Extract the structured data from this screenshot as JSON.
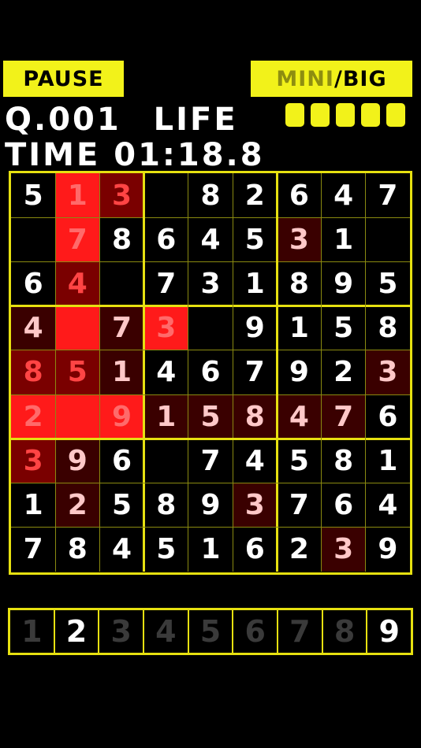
{
  "buttons": {
    "pause": "PAUSE",
    "mini": "MINI",
    "slash": "/",
    "big": "BIG"
  },
  "hud": {
    "question_label": "Q.",
    "question_number": "001",
    "life_label": "LIFE",
    "life_remaining": 5,
    "time_label": "TIME",
    "time_value": "01:18.8"
  },
  "colors": {
    "accent_yellow": "#f2f21a",
    "grid_line": "#e6e010",
    "red_bright": "#ff1a1a",
    "red_mid": "#c01010",
    "red_dark": "#7a0000",
    "red_faint": "#3a0000"
  },
  "board": {
    "rows": [
      [
        "5",
        "1",
        "3",
        "",
        "8",
        "2",
        "6",
        "4",
        "7"
      ],
      [
        "",
        "7",
        "8",
        "6",
        "4",
        "5",
        "3",
        "1",
        ""
      ],
      [
        "6",
        "4",
        "",
        "7",
        "3",
        "1",
        "8",
        "9",
        "5"
      ],
      [
        "4",
        "",
        "7",
        "3",
        "",
        "9",
        "1",
        "5",
        "8"
      ],
      [
        "8",
        "5",
        "1",
        "4",
        "6",
        "7",
        "9",
        "2",
        "3"
      ],
      [
        "2",
        "",
        "9",
        "1",
        "5",
        "8",
        "4",
        "7",
        "6"
      ],
      [
        "3",
        "9",
        "6",
        "",
        "7",
        "4",
        "5",
        "8",
        "1"
      ],
      [
        "1",
        "2",
        "5",
        "8",
        "9",
        "3",
        "7",
        "6",
        "4"
      ],
      [
        "7",
        "8",
        "4",
        "5",
        "1",
        "6",
        "2",
        "3",
        "9"
      ]
    ],
    "shade": [
      [
        0,
        3,
        2,
        0,
        0,
        0,
        0,
        0,
        0
      ],
      [
        0,
        3,
        0,
        0,
        0,
        0,
        1,
        0,
        0
      ],
      [
        0,
        2,
        0,
        0,
        0,
        0,
        0,
        0,
        0
      ],
      [
        1,
        3,
        1,
        3,
        0,
        0,
        0,
        0,
        0
      ],
      [
        2,
        2,
        1,
        0,
        0,
        0,
        0,
        0,
        1
      ],
      [
        3,
        3,
        3,
        1,
        1,
        1,
        1,
        1,
        0
      ],
      [
        2,
        1,
        0,
        0,
        0,
        0,
        0,
        0,
        0
      ],
      [
        0,
        1,
        0,
        0,
        0,
        1,
        0,
        0,
        0
      ],
      [
        0,
        0,
        0,
        0,
        0,
        0,
        0,
        1,
        0
      ]
    ]
  },
  "numbers": [
    {
      "label": "1",
      "state": "disabled"
    },
    {
      "label": "2",
      "state": "active"
    },
    {
      "label": "3",
      "state": "disabled"
    },
    {
      "label": "4",
      "state": "disabled"
    },
    {
      "label": "5",
      "state": "disabled"
    },
    {
      "label": "6",
      "state": "disabled"
    },
    {
      "label": "7",
      "state": "disabled"
    },
    {
      "label": "8",
      "state": "disabled"
    },
    {
      "label": "9",
      "state": "active"
    }
  ]
}
